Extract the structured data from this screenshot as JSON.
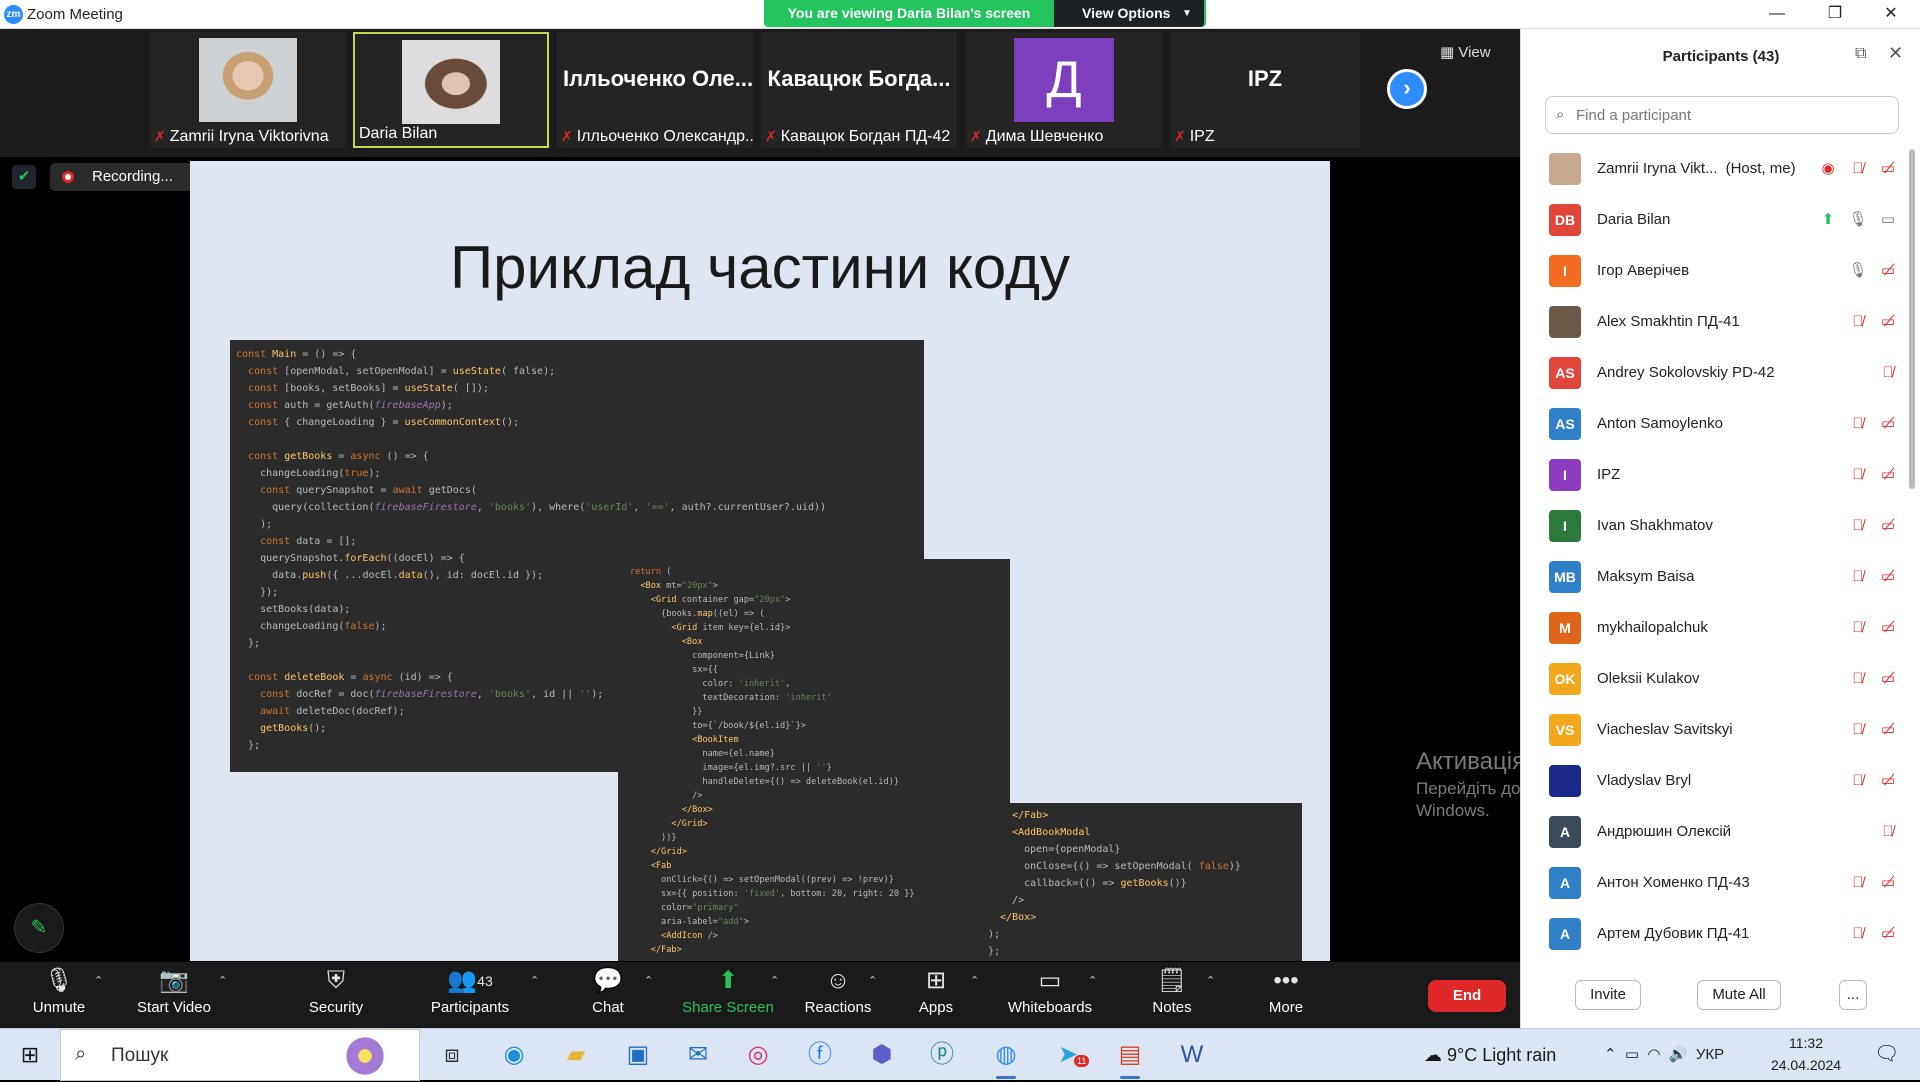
{
  "window": {
    "title": "Zoom Meeting",
    "logo": "zm"
  },
  "banner": {
    "viewing": "You are viewing Daria Bilan's screen",
    "view_options": "View Options"
  },
  "strip": {
    "tiles": [
      {
        "name": "Zamrii Iryna Viktorivna",
        "muted": true
      },
      {
        "name": "Daria Bilan",
        "muted": false
      },
      {
        "big": "Ілльоченко Оле...",
        "name": "Ілльоченко Олександр...",
        "muted": true
      },
      {
        "big": "Кавацюк Богда...",
        "name": "Кавацюк Богдан ПД-42",
        "muted": true
      },
      {
        "avatar": "Д",
        "name": "Дима Шевченко",
        "muted": true
      },
      {
        "big": "IPZ",
        "name": "IPZ",
        "muted": true
      }
    ],
    "view_label": "View"
  },
  "recording": {
    "label": "Recording..."
  },
  "slide": {
    "title": "Приклад частини коду"
  },
  "watermark": {
    "line1": "Активація Windows",
    "line2": "Перейдіть до розділу \"Настройки\", щоб активувати",
    "line3": "Windows."
  },
  "toolbar": {
    "unmute": "Unmute",
    "start_video": "Start Video",
    "security": "Security",
    "participants": "Participants",
    "participants_count": "43",
    "chat": "Chat",
    "share_screen": "Share Screen",
    "reactions": "Reactions",
    "apps": "Apps",
    "whiteboards": "Whiteboards",
    "notes": "Notes",
    "more": "More",
    "end": "End"
  },
  "panel": {
    "title": "Participants (43)",
    "search_placeholder": "Find a participant",
    "participants": [
      {
        "initials": "",
        "photo": true,
        "name": "Zamrii Iryna Vikt...",
        "role": "(Host, me)",
        "color": "#c9a98d"
      },
      {
        "initials": "DB",
        "name": "Daria Bilan",
        "color": "#e0463a"
      },
      {
        "initials": "І",
        "name": "Ігор Аверічев",
        "color": "#f26b21"
      },
      {
        "initials": "",
        "photo": true,
        "name": "Alex Smakhtin ПД-41",
        "color": "#6b5a4a"
      },
      {
        "initials": "AS",
        "name": "Andrey Sokolovskiy PD-42",
        "color": "#e0463a"
      },
      {
        "initials": "AS",
        "name": "Anton Samoylenko",
        "color": "#2f80c7"
      },
      {
        "initials": "I",
        "name": "IPZ",
        "color": "#8c3cbf"
      },
      {
        "initials": "I",
        "name": "Ivan Shakhmatov",
        "color": "#2b7a3a"
      },
      {
        "initials": "MB",
        "name": "Maksym Baisa",
        "color": "#2f80c7"
      },
      {
        "initials": "M",
        "name": "mykhailopalchuk",
        "color": "#e0631a"
      },
      {
        "initials": "OK",
        "name": "Oleksii Kulakov",
        "color": "#f2a81d"
      },
      {
        "initials": "VS",
        "name": "Viacheslav Savitskyi",
        "color": "#f2a81d"
      },
      {
        "initials": "",
        "photo": true,
        "name": "Vladyslav Bryl",
        "color": "#1b2a8a"
      },
      {
        "initials": "А",
        "name": "Андрюшин Олексій",
        "color": "#3b4a58"
      },
      {
        "initials": "А",
        "name": "Антон Хоменко ПД-43",
        "color": "#2f80c7"
      },
      {
        "initials": "А",
        "name": "Артем Дубовик ПД-41",
        "color": "#2f80c7"
      }
    ],
    "invite": "Invite",
    "mute_all": "Mute All",
    "more": "..."
  },
  "taskbar": {
    "search": "Пошук",
    "weather": "9°C  Light rain",
    "lang": "УКР",
    "time": "11:32",
    "date": "24.04.2024",
    "telegram_badge": "11",
    "notif_count": "1"
  }
}
